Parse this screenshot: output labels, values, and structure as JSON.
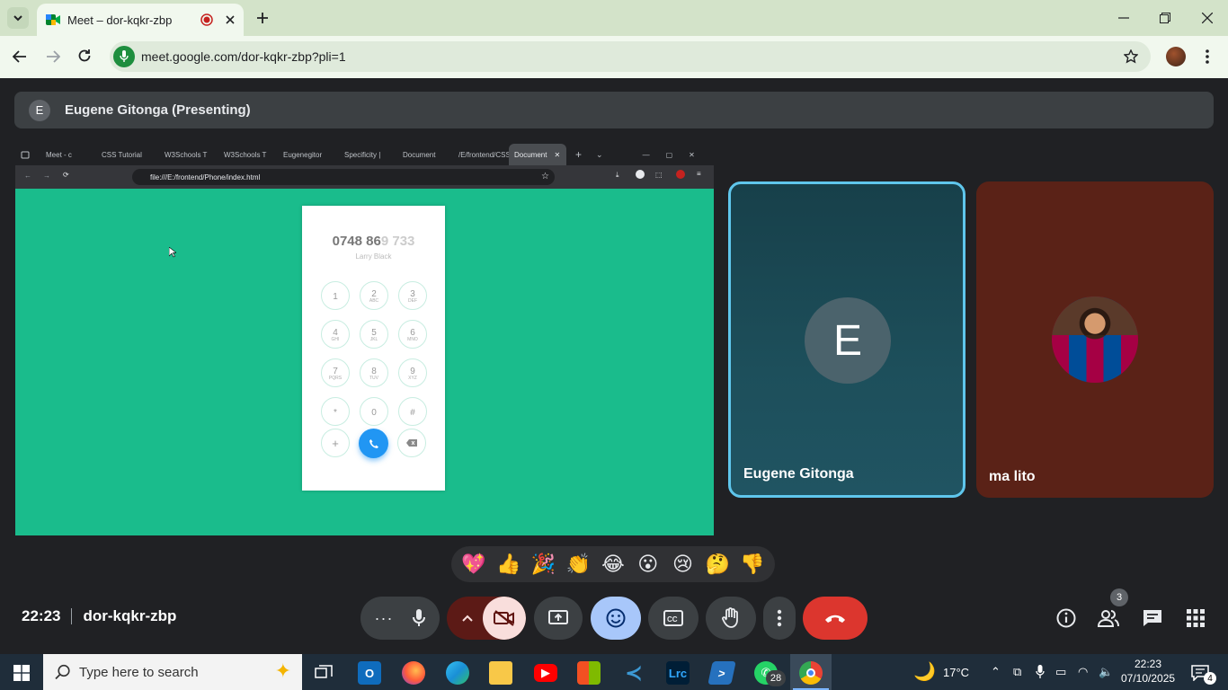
{
  "browser": {
    "tab_title": "Meet – dor-kqkr-zbp",
    "url": "meet.google.com/dor-kqkr-zbp?pli=1"
  },
  "presenter": {
    "initial": "E",
    "label": "Eugene Gitonga (Presenting)"
  },
  "shared_screen": {
    "tabs": [
      "Meet - c",
      "CSS Tutorial",
      "W3Schools T",
      "W3Schools T",
      "Eugenegitor",
      "Specificity |",
      "Document",
      "/E/frontend/CSS",
      "Document"
    ],
    "url": "file:///E:/frontend/Phone/index.html",
    "dialer": {
      "number_typed": "0748 86",
      "number_hint": "9 733",
      "contact": "Larry Black",
      "keys": [
        {
          "n": "1",
          "s": ""
        },
        {
          "n": "2",
          "s": "ABC"
        },
        {
          "n": "3",
          "s": "DEF"
        },
        {
          "n": "4",
          "s": "GHI"
        },
        {
          "n": "5",
          "s": "JKL"
        },
        {
          "n": "6",
          "s": "MNO"
        },
        {
          "n": "7",
          "s": "PQRS"
        },
        {
          "n": "8",
          "s": "TUV"
        },
        {
          "n": "9",
          "s": "XYZ"
        },
        {
          "n": "*",
          "s": ""
        },
        {
          "n": "0",
          "s": ""
        },
        {
          "n": "#",
          "s": ""
        }
      ],
      "plus_label": "+"
    }
  },
  "participants": [
    {
      "name": "Eugene Gitonga",
      "initial": "E"
    },
    {
      "name": "ma lito"
    }
  ],
  "reactions": [
    "💖",
    "👍",
    "🎉",
    "👏",
    "😂",
    "😮",
    "😢",
    "🤔",
    "👎"
  ],
  "meeting": {
    "time": "22:23",
    "code": "dor-kqkr-zbp",
    "people_count": "3"
  },
  "taskbar": {
    "search_placeholder": "Type here to search",
    "whatsapp_badge": "28",
    "temperature": "17°C",
    "clock_time": "22:23",
    "clock_date": "07/10/2025",
    "notifications": "4"
  },
  "colors": {
    "accent_blue": "#8ab4f8",
    "end_call_red": "#ea4335",
    "shared_teal": "#1abc8c",
    "active_tile_border": "#5fc6ec"
  }
}
